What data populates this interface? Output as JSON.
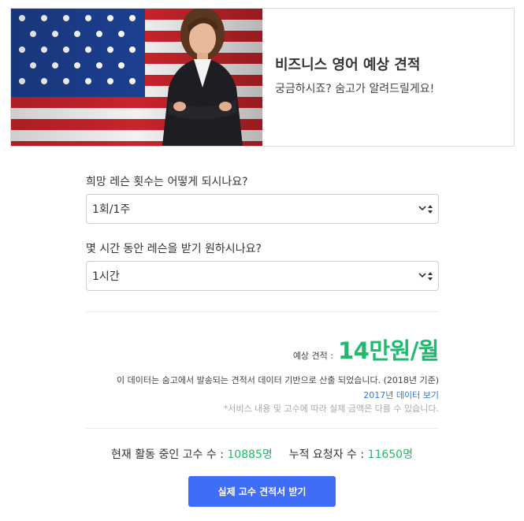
{
  "hero": {
    "title": "비즈니스 영어 예상 견적",
    "subtitle": "궁금하시죠? 숨고가 알려드릴게요!"
  },
  "questions": [
    {
      "label": "희망 레슨 횟수는 어떻게 되시나요?",
      "selected": "1회/1주"
    },
    {
      "label": "몇 시간 동안 레슨을 받기 원하시나요?",
      "selected": "1시간"
    }
  ],
  "estimate": {
    "label": "예상 견적 :",
    "value": "14만원/월"
  },
  "notes": {
    "source": "이 데이터는 숨고에서 발송되는 견적서 데이터 기반으로 산출 되었습니다. (2018년 기준)",
    "link": "2017년 데이터 보기",
    "disclaimer": "*서비스 내용 및 고수에 따라 실제 금액은 다를 수 있습니다."
  },
  "stats": {
    "active_label": "현재 활동 중인 고수 수 :",
    "active_value": "10885명",
    "requests_label": "누적 요청자 수 :",
    "requests_value": "11650명"
  },
  "cta": {
    "label": "실제 고수 견적서 받기"
  },
  "colors": {
    "accent_green": "#1fba6e",
    "cta_blue": "#3f6df5",
    "link_blue": "#2a7be0"
  }
}
